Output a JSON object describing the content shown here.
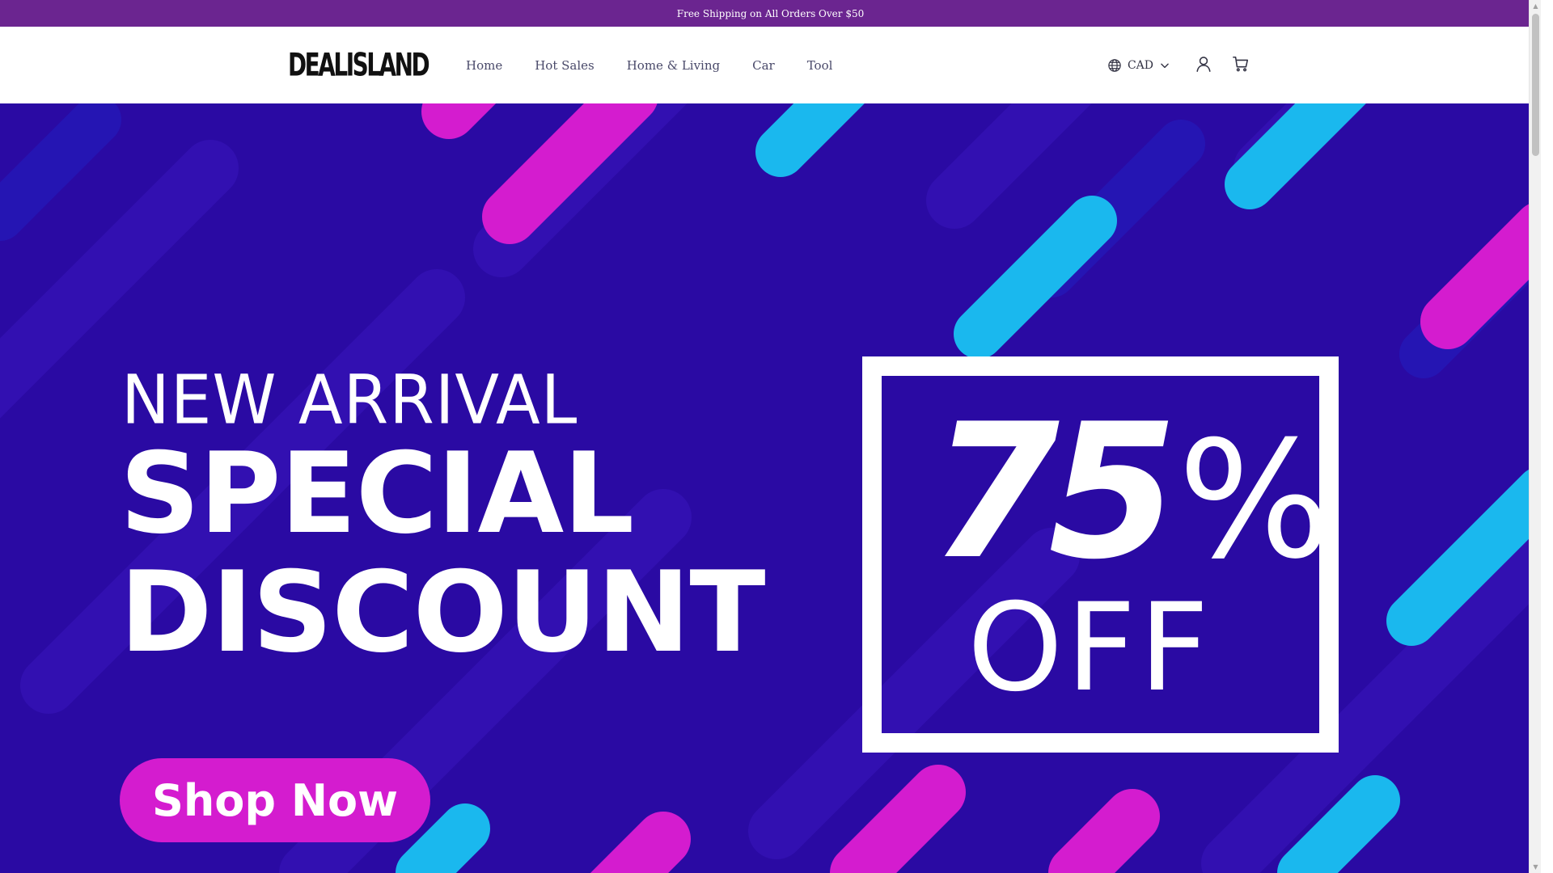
{
  "announcement": {
    "text": "Free Shipping on All Orders Over $50"
  },
  "header": {
    "logo": "DEALISLAND",
    "nav": [
      "Home",
      "Hot Sales",
      "Home & Living",
      "Car",
      "Tool"
    ],
    "currency": "CAD",
    "icons": {
      "currency": "globe-icon",
      "dropdown": "chevron-down-icon",
      "account": "user-icon",
      "cart": "cart-icon"
    }
  },
  "hero": {
    "line1": "NEW ARRIVAL",
    "line2": "SPECIAL",
    "line3": "DISCOUNT",
    "percent": "75",
    "percent_symbol": "%",
    "off": "OFF",
    "cta": "Shop Now",
    "colors": {
      "background": "#2a0aa3",
      "magenta": "#d41ccf",
      "cyan": "#1ab8ee"
    }
  }
}
